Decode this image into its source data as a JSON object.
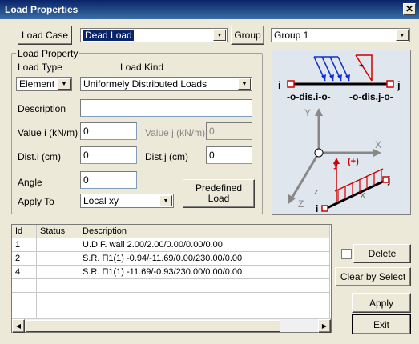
{
  "window": {
    "title": "Load Properties",
    "close_glyph": "✕"
  },
  "load_case": {
    "label": "Load Case",
    "value": "Dead Load"
  },
  "group": {
    "label": "Group",
    "value": "Group 1"
  },
  "load_property": {
    "legend": "Load Property",
    "load_type_label": "Load Type",
    "load_kind_label": "Load Kind",
    "load_type_value": "Element",
    "load_kind_value": "Uniformely Distributed Loads",
    "description_label": "Description",
    "description_value": "",
    "value_i_label": "Value i (kN/m)",
    "value_i": "0",
    "value_j_label": "Value j (kN/m)",
    "value_j": "0",
    "dist_i_label": "Dist.i (cm)",
    "dist_i": "0",
    "dist_j_label": "Dist.j (cm)",
    "dist_j": "0",
    "angle_label": "Angle",
    "angle": "0",
    "apply_to_label": "Apply To",
    "apply_to_value": "Local xy",
    "predefined_label_1": "Predefined",
    "predefined_label_2": "Load"
  },
  "diagram": {
    "i_label": "i",
    "j_label": "j",
    "dis_i": "-o-dis.i-o-",
    "dis_j": "-o-dis.j-o-",
    "axis_y": "Y",
    "axis_x": "X",
    "axis_z": "Z",
    "local_y": "y",
    "plus": "(+)",
    "local_x": "x",
    "local_z": "z",
    "elem_j": "j",
    "elem_i": "i"
  },
  "table": {
    "columns": [
      "Id",
      "Status",
      "Description"
    ],
    "rows": [
      {
        "id": "1",
        "status": "",
        "description": "U.D.F. wall 2.00/2.00/0.00/0.00/0.00"
      },
      {
        "id": "2",
        "status": "",
        "description": "S.R. Π1(1) -0.94/-11.69/0.00/230.00/0.00"
      },
      {
        "id": "4",
        "status": "",
        "description": "S.R. Π1(1) -11.69/-0.93/230.00/0.00/0.00"
      }
    ]
  },
  "buttons": {
    "delete": "Delete",
    "clear_by_select": "Clear by Select",
    "apply": "Apply",
    "exit": "Exit"
  },
  "scroll": {
    "left_glyph": "◀",
    "right_glyph": "▶"
  },
  "combo_arrow_glyph": "▼"
}
